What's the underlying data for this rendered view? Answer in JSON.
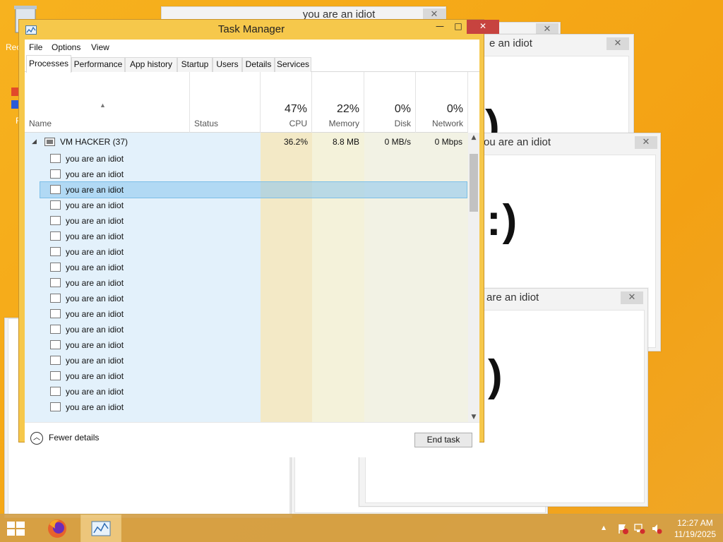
{
  "desktop": {
    "icon_labels": [
      "Rec",
      "F"
    ]
  },
  "popups": {
    "title_top": "you are an idiot",
    "title_1": "e an idiot",
    "title_2": "ou are an idiot",
    "title_3": "are an idiot",
    "smile_2": ":)",
    "smile_1": ")",
    "smile_3": ")",
    "close_glyph": "✕"
  },
  "task_manager": {
    "title": "Task Manager",
    "window_buttons": {
      "minimize": "—",
      "maximize": "□",
      "close": "✕"
    },
    "menu": [
      "File",
      "Options",
      "View"
    ],
    "tabs": [
      "Processes",
      "Performance",
      "App history",
      "Startup",
      "Users",
      "Details",
      "Services"
    ],
    "active_tab": "Processes",
    "columns": {
      "name": "Name",
      "status": "Status",
      "cpu": {
        "pct": "47%",
        "label": "CPU"
      },
      "memory": {
        "pct": "22%",
        "label": "Memory"
      },
      "disk": {
        "pct": "0%",
        "label": "Disk"
      },
      "network": {
        "pct": "0%",
        "label": "Network"
      }
    },
    "group": {
      "name": "VM HACKER (37)",
      "cpu": "36.2%",
      "memory": "8.8 MB",
      "disk": "0 MB/s",
      "network": "0 Mbps"
    },
    "child_rows": [
      "you are an idiot",
      "you are an idiot",
      "you are an idiot",
      "you are an idiot",
      "you are an idiot",
      "you are an idiot",
      "you are an idiot",
      "you are an idiot",
      "you are an idiot",
      "you are an idiot",
      "you are an idiot",
      "you are an idiot",
      "you are an idiot",
      "you are an idiot",
      "you are an idiot",
      "you are an idiot",
      "you are an idiot"
    ],
    "selected_row_index": 2,
    "footer": {
      "fewer_details": "Fewer details",
      "end_task": "End task"
    }
  },
  "taskbar": {
    "time": "12:27 AM",
    "date": "11/19/2025",
    "tray_arrow": "▲"
  },
  "colors": {
    "accent_window": "#f6c84b",
    "close_red": "#c7433f",
    "cpu_column": "#f3e7c4",
    "memory_column": "#f3f1d9",
    "selection": "#9fd1f0"
  }
}
